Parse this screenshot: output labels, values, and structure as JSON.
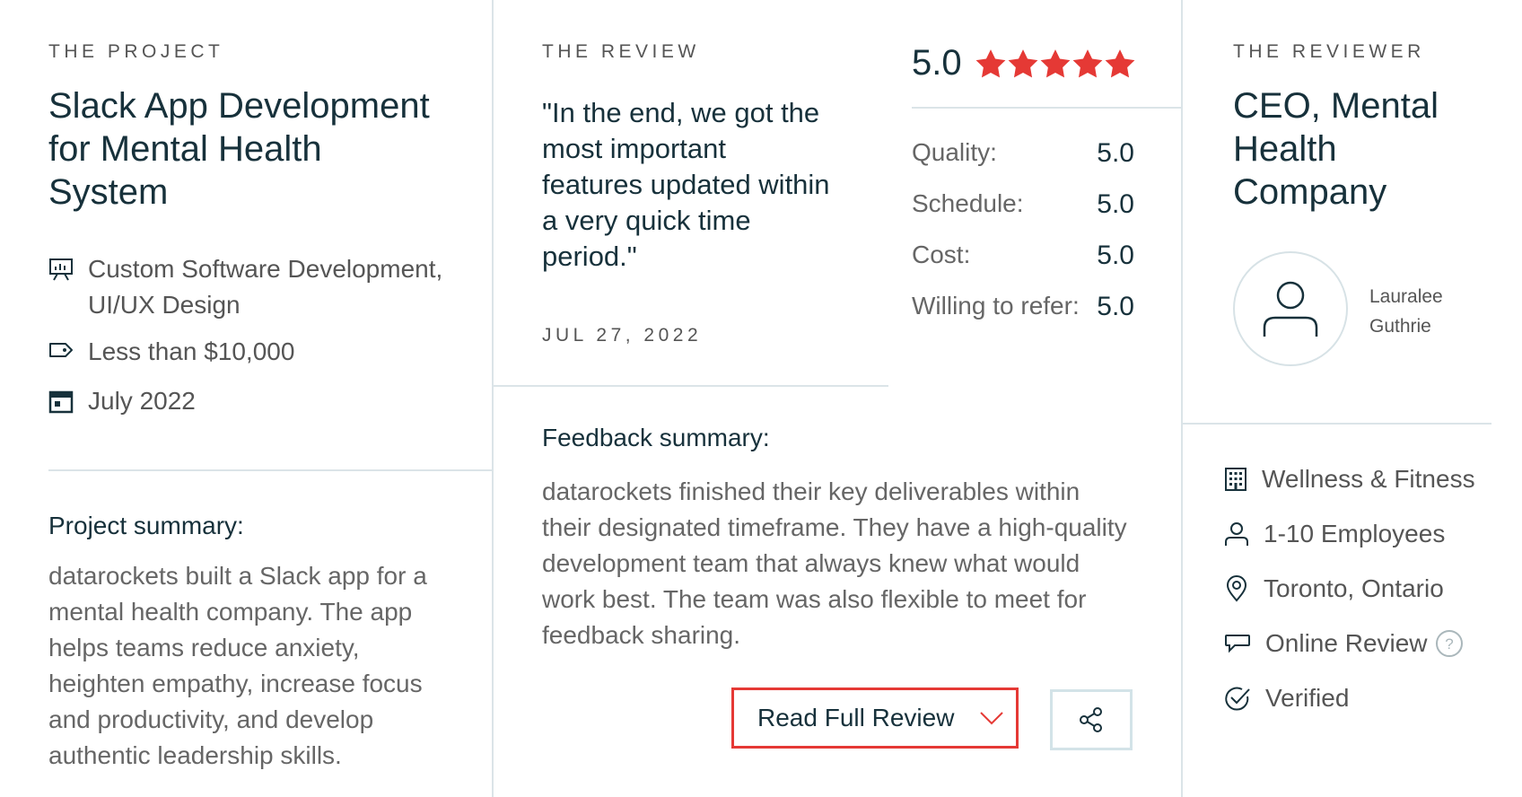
{
  "project": {
    "eyebrow": "THE PROJECT",
    "title_lines": [
      "Slack App Development",
      "for Mental Health",
      "System"
    ],
    "services_line1": "Custom Software Development,",
    "services_line2": "UI/UX Design",
    "budget": "Less than $10,000",
    "date": "July 2022",
    "summary_heading": "Project summary:",
    "summary_lines": [
      "datarockets built a Slack app for a",
      "mental health company. The app",
      "helps teams reduce anxiety,",
      "heighten empathy, increase focus",
      "and productivity, and develop",
      "authentic leadership skills."
    ],
    "icons": [
      "presentation-icon",
      "tag-icon",
      "calendar-icon"
    ]
  },
  "review": {
    "eyebrow": "THE REVIEW",
    "quote_lines": [
      "\"In the end, we got the",
      "most important",
      "features updated within",
      "a very quick time",
      "period.\""
    ],
    "date": "JUL 27, 2022",
    "overall": "5.0",
    "stars": 5,
    "star_color": "#e53935",
    "ratings": [
      {
        "label": "Quality:",
        "value": "5.0"
      },
      {
        "label": "Schedule:",
        "value": "5.0"
      },
      {
        "label": "Cost:",
        "value": "5.0"
      },
      {
        "label": "Willing to refer:",
        "value": "5.0"
      }
    ],
    "feedback_heading": "Feedback summary:",
    "feedback_lines": [
      "datarockets finished their key deliverables within",
      "their designated timeframe. They have a high-quality",
      "development team that always knew what would",
      "work best. The team was also flexible to meet for",
      "feedback sharing."
    ],
    "read_full_label": "Read Full Review",
    "button_border_color": "#e53935",
    "icons": [
      "chevron-down-icon",
      "share-icon"
    ]
  },
  "reviewer": {
    "eyebrow": "THE REVIEWER",
    "title_lines": [
      "CEO, Mental",
      "Health",
      "Company"
    ],
    "name_line1": "Lauralee",
    "name_line2": "Guthrie",
    "industry": "Wellness & Fitness",
    "employees": "1-10 Employees",
    "location": "Toronto, Ontario",
    "review_type": "Online Review",
    "verified": "Verified",
    "icons": [
      "building-icon",
      "person-icon",
      "location-pin-icon",
      "chat-bubble-icon",
      "help-icon",
      "check-circle-icon"
    ]
  }
}
